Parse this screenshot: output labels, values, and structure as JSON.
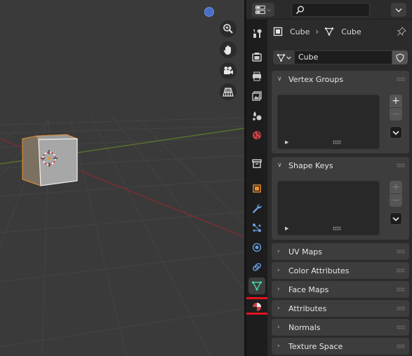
{
  "header": {
    "editor_type_icon": "properties-editor-icon",
    "search_placeholder": ""
  },
  "tabs": [
    {
      "name": "tab-tool",
      "icon": "tool-icon"
    },
    {
      "name": "tab-render",
      "icon": "render-icon"
    },
    {
      "name": "tab-output",
      "icon": "output-icon"
    },
    {
      "name": "tab-view-layer",
      "icon": "view-layer-icon"
    },
    {
      "name": "tab-scene",
      "icon": "scene-icon"
    },
    {
      "name": "tab-world",
      "icon": "world-icon"
    },
    {
      "name": "tab-collection",
      "icon": "collection-icon"
    },
    {
      "name": "tab-object",
      "icon": "object-icon"
    },
    {
      "name": "tab-modifiers",
      "icon": "wrench-icon"
    },
    {
      "name": "tab-particles",
      "icon": "particles-icon"
    },
    {
      "name": "tab-physics",
      "icon": "physics-icon"
    },
    {
      "name": "tab-constraints",
      "icon": "constraints-icon"
    },
    {
      "name": "tab-object-data",
      "icon": "mesh-data-icon",
      "active": true
    },
    {
      "name": "tab-material",
      "icon": "material-icon"
    }
  ],
  "breadcrumb": {
    "object_name": "Cube",
    "data_name": "Cube"
  },
  "datablock": {
    "name": "Cube"
  },
  "panels": {
    "vertex_groups": "Vertex Groups",
    "shape_keys": "Shape Keys",
    "uv_maps": "UV Maps",
    "color_attributes": "Color Attributes",
    "face_maps": "Face Maps",
    "attributes": "Attributes",
    "normals": "Normals",
    "texture_space": "Texture Space"
  },
  "list_buttons": {
    "add": "+",
    "remove": "−",
    "menu": "⌄"
  },
  "colors": {
    "accent_active_tab": "#3d3d3d",
    "highlight_red": "#e0141e",
    "selection_orange": "#e8912f"
  }
}
